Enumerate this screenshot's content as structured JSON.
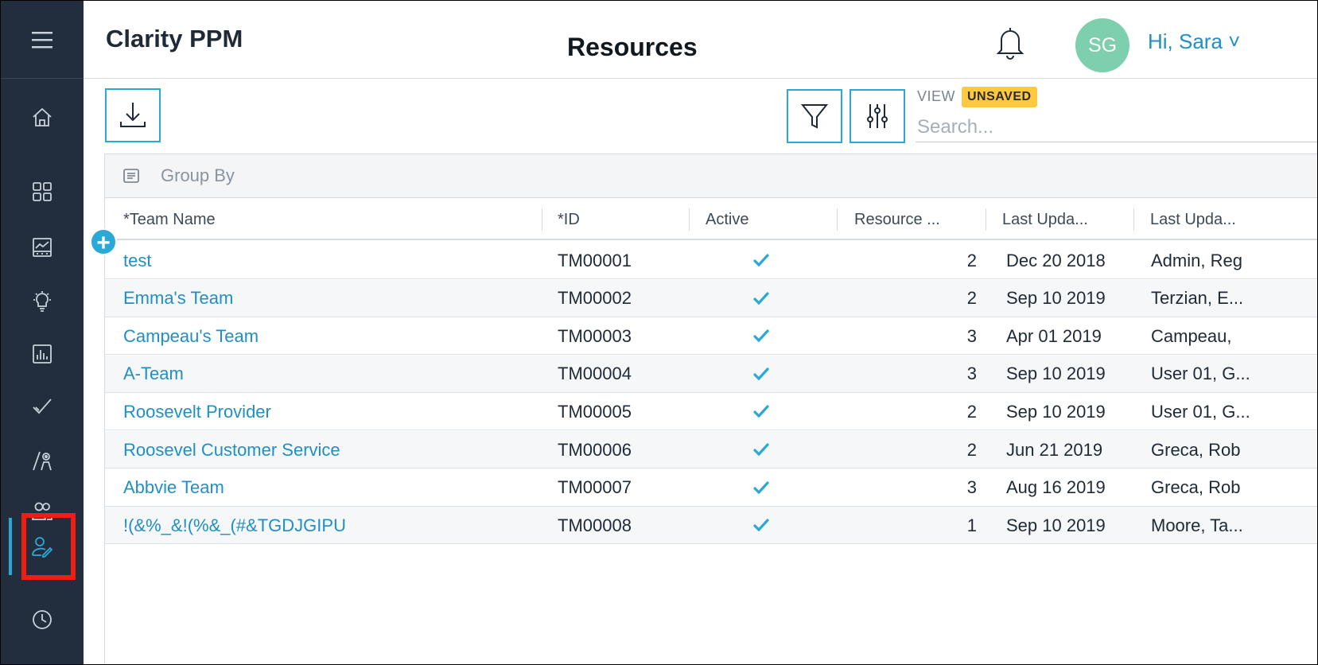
{
  "app": {
    "title": "Clarity PPM",
    "page_title": "Resources"
  },
  "user": {
    "initials": "SG",
    "greeting": "Hi, Sara ˅"
  },
  "toolbar": {
    "view_label": "VIEW",
    "unsaved_badge": "UNSAVED",
    "search_placeholder": "Search..."
  },
  "nav": {
    "items": [
      "menu-icon",
      "home-icon",
      "dashboard-grid-icon",
      "chart-board-icon",
      "lightbulb-icon",
      "bar-chart-icon",
      "checkmark-icon",
      "staffing-icon",
      "teams-icon",
      "resource-edit-icon",
      "clock-icon"
    ],
    "active": "resource-edit-icon"
  },
  "grid": {
    "group_by_label": "Group By",
    "columns": [
      "*Team Name",
      "*ID",
      "Active",
      "Resource ...",
      "Last Upda...",
      "Last Upda..."
    ],
    "rows": [
      {
        "name": "test",
        "id": "TM00001",
        "active": true,
        "resources": "2",
        "updated": "Dec 20 2018",
        "updated_by": "Admin, Reg"
      },
      {
        "name": "Emma's Team",
        "id": "TM00002",
        "active": true,
        "resources": "2",
        "updated": "Sep 10 2019",
        "updated_by": "Terzian, E..."
      },
      {
        "name": "Campeau's Team",
        "id": "TM00003",
        "active": true,
        "resources": "3",
        "updated": "Apr 01 2019",
        "updated_by": "Campeau,"
      },
      {
        "name": "A-Team",
        "id": "TM00004",
        "active": true,
        "resources": "3",
        "updated": "Sep 10 2019",
        "updated_by": "User 01, G..."
      },
      {
        "name": "Roosevelt Provider",
        "id": "TM00005",
        "active": true,
        "resources": "2",
        "updated": "Sep 10 2019",
        "updated_by": "User 01, G..."
      },
      {
        "name": "Roosevel Customer Service",
        "id": "TM00006",
        "active": true,
        "resources": "2",
        "updated": "Jun 21 2019",
        "updated_by": "Greca, Rob"
      },
      {
        "name": "Abbvie Team",
        "id": "TM00007",
        "active": true,
        "resources": "3",
        "updated": "Aug 16 2019",
        "updated_by": "Greca, Rob"
      },
      {
        "name": "!(&%_&!(%&_(#&TGDJGIPU",
        "id": "TM00008",
        "active": true,
        "resources": "1",
        "updated": "Sep 10 2019",
        "updated_by": "Moore, Ta..."
      }
    ]
  },
  "colors": {
    "nav_bg": "#222e3e",
    "accent": "#2aa8d6",
    "link": "#1f8fc4",
    "badge": "#ffc93f",
    "avatar": "#7dcfae",
    "highlight": "#f01e12"
  }
}
